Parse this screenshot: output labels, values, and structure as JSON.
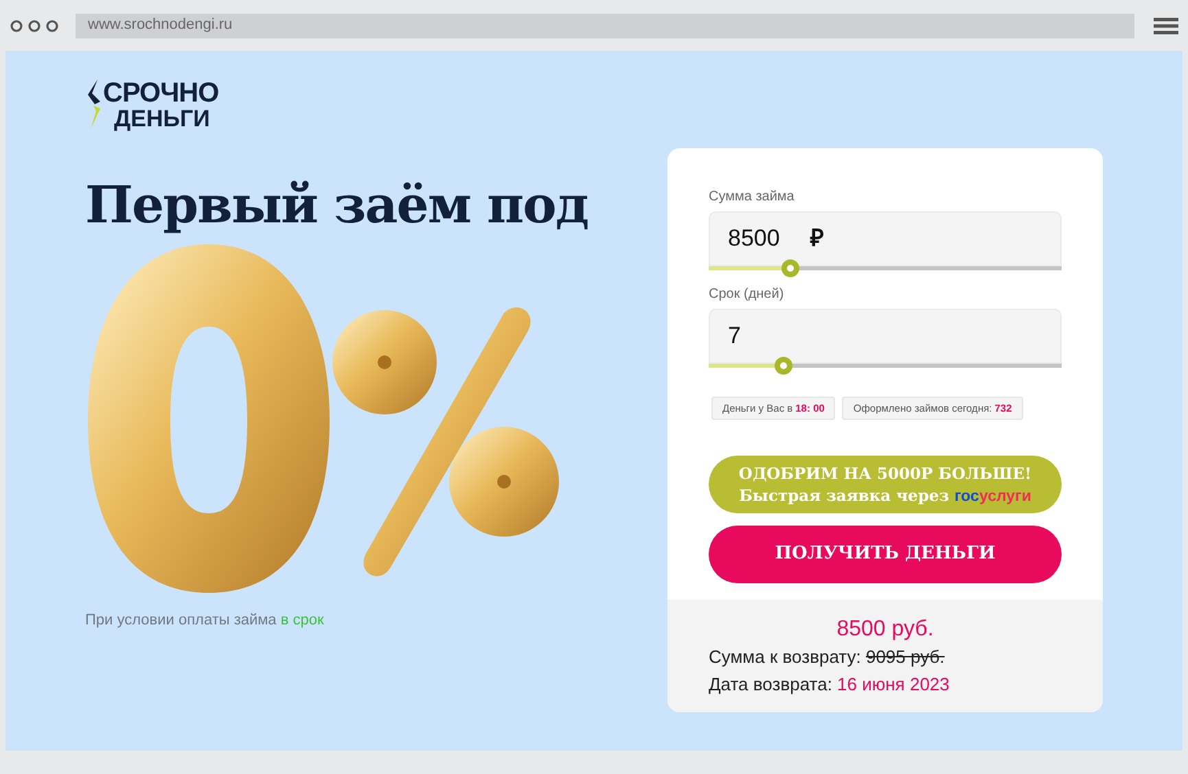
{
  "browser": {
    "url": "www.srochnodengi.ru"
  },
  "logo": {
    "line1": "СРОЧНО",
    "line2": "ДЕНЬГИ"
  },
  "hero": {
    "heading": "Первый заём под",
    "note": "При условии оплаты займа",
    "note_link": "в срок"
  },
  "form": {
    "fields": [
      {
        "label": "Сумма займа",
        "value": "8500",
        "unit": "₽",
        "level": 0.23
      },
      {
        "label": "Срок (дней)",
        "value": "7",
        "level": 0.21
      }
    ],
    "chips": [
      {
        "text": "Деньги у Вас в",
        "value": "18: 00"
      },
      {
        "text": "Оформлено займов сегодня:",
        "value": "732"
      }
    ],
    "promo_button": {
      "line1": "ОДОБРИМ НА 5000Р БОЛЬШЕ!",
      "line2": "Быстрая заявка через",
      "brand_part1": "гос",
      "brand_part2": "услуги"
    },
    "submit_button": "ПОЛУЧИТЬ ДЕНЬГИ"
  },
  "summary": {
    "new_amount": "8500 руб.",
    "return_label": "Сумма к возврату:",
    "old_amount": "9095 руб.",
    "date_label": "Дата возврата:",
    "date": "16 июня 2023"
  }
}
